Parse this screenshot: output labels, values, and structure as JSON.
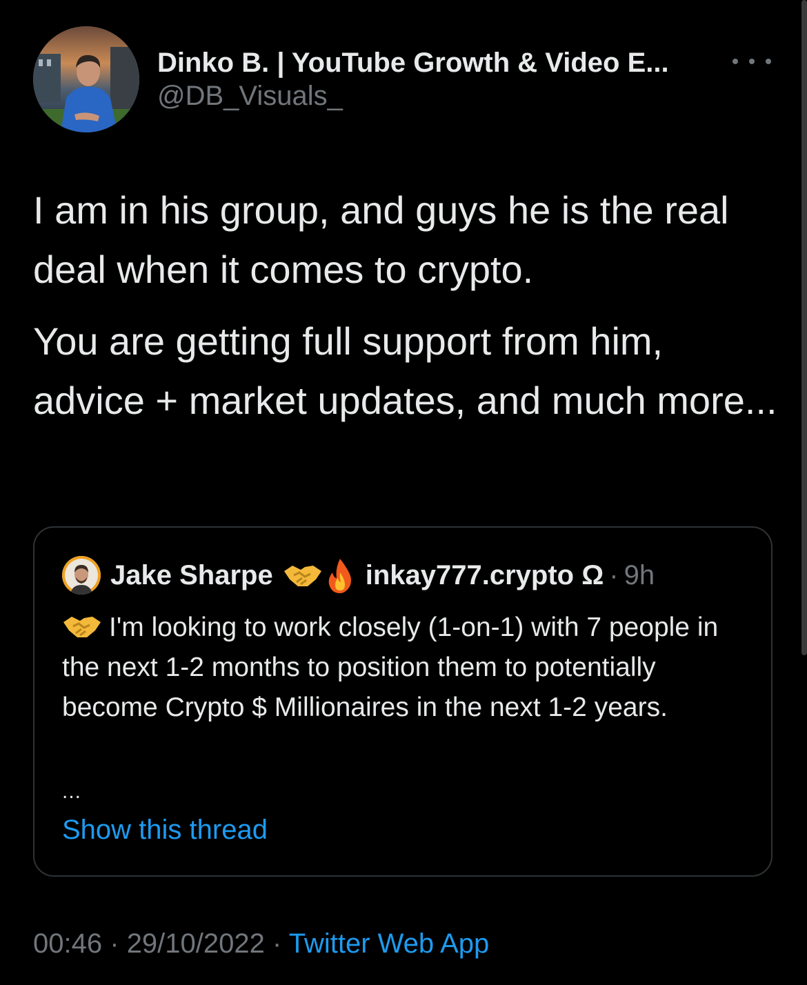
{
  "tweet": {
    "author": {
      "name": "Dinko B. | YouTube Growth & Video E...",
      "handle": "@DB_Visuals_"
    },
    "more_icon": "more-horizontal-icon",
    "paragraphs": [
      "I am in his group, and guys he is the real deal when it comes to crypto.",
      "You are getting full support from him, advice + market updates, and much more..."
    ]
  },
  "quoted_tweet": {
    "author_name": "Jake Sharpe",
    "author_name_suffix": "inkay777.crypto Ω",
    "name_emojis": [
      "handshake-emoji",
      "fire-emoji"
    ],
    "separator": "·",
    "time_ago": "9h",
    "body_emoji": "handshake-emoji",
    "body": "I'm looking to work closely (1-on-1) with 7 people in the next 1-2 months to position them to potentially become Crypto $ Millionaires in the next 1-2 years.",
    "ellipsis": "...",
    "show_thread": "Show this thread"
  },
  "footer": {
    "time": "00:46",
    "separator": "·",
    "date": "29/10/2022",
    "source": "Twitter Web App"
  },
  "colors": {
    "background": "#000000",
    "primary_text": "#e7e9ea",
    "secondary_text": "#71767b",
    "link": "#1d9bf0",
    "border": "#2f3336"
  }
}
